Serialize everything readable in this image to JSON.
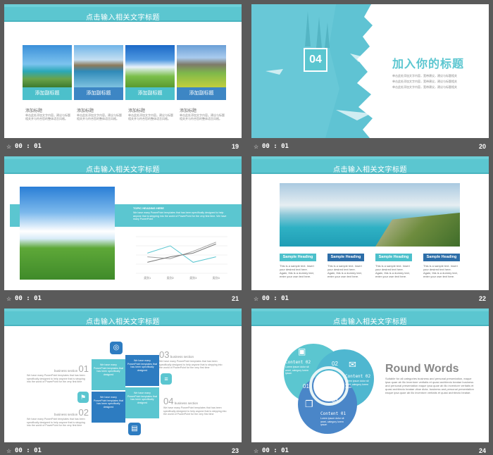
{
  "slides": [
    {
      "id": "s19",
      "number": "19",
      "time": "00 : 01",
      "title": "点击输入相关文字标题",
      "buttons": [
        "添加副标题",
        "添加副标题",
        "添加副标题",
        "添加副标题"
      ],
      "captions": [
        {
          "heading": "添加标题",
          "body": "单击此处添加文字内容。建议与标题相关并与符合您的整体语言风格。"
        },
        {
          "heading": "添加标题",
          "body": "单击此处添加文字内容。建议与标题相关并与符合您的整体语言风格。"
        },
        {
          "heading": "添加标题",
          "body": "单击此处添加文字内容。建议与标题相关并与符合您的整体语言风格。"
        },
        {
          "heading": "添加标题",
          "body": "单击此处添加文字内容。建议与标题相关并与符合您的整体语言风格。"
        }
      ]
    },
    {
      "id": "s20",
      "number": "20",
      "time": "00 : 01",
      "section_number": "04",
      "heading": "加入你的标题",
      "body_lines": [
        "单击此处添加文字内容，宽带建议，建议与标题相关",
        "单击此处添加文字内容，宽带建议，建议与标题相关",
        "单击此处添加文字内容，宽带建议，建议与标题相关"
      ]
    },
    {
      "id": "s21",
      "number": "21",
      "time": "00 : 01",
      "title": "点击输入相关文字标题",
      "text_heading": "TOPIC HEADING HERE",
      "text_body": "We have many PowerPoint templates that has been specifically designed to help anyone that is stepping into the world of PowerPoint for the very first time. We have many PowerPoint",
      "x_labels": [
        "类别1",
        "类别2",
        "类别3",
        "类别4"
      ]
    },
    {
      "id": "s22",
      "number": "22",
      "time": "00 : 01",
      "title": "点击输入相关文字标题",
      "headings": [
        "Sample  Heading",
        "Sample  Heading",
        "Sample  Heading",
        "Sample  Heading"
      ],
      "body": "This is a sample text. Insert your desired text here. Again, this is a dummy text, enter your own text here."
    },
    {
      "id": "s23",
      "number": "23",
      "time": "00 : 01",
      "title": "点击输入相关文字标题",
      "sections": [
        {
          "num": "01",
          "label": "business section",
          "text": "We have many PowerPoint templates that has been specifically designed to help anyone that is stepping into the world of PowerPoint for the very first time"
        },
        {
          "num": "02",
          "label": "business section",
          "text": "We have many PowerPoint templates that has been specifically designed to help anyone that is stepping into the world of PowerPoint for the very first time"
        },
        {
          "num": "03",
          "label": "business section",
          "text": "We have many PowerPoint templates that has been specifically designed to help anyone that is stepping into the world of PowerPoint for the very first time"
        },
        {
          "num": "04",
          "label": "business section",
          "text": "We have many PowerPoint templates that has been specifically designed to help anyone that is stepping into the world of PowerPoint for the very first time"
        }
      ],
      "box_text": "We have many PowerPoint templates that has been specifically designed"
    },
    {
      "id": "s24",
      "number": "24",
      "time": "00 : 01",
      "title": "点击输入相关文字标题",
      "heading": "Round Words",
      "body": "Suitable for all categories business and personal presentation, eaque ipsa quae ab illo inventore veritatis et quasi architecto beatae business and personal presentation eaque ipsa quae ab illo inventore veritatis et quasi architecto beatae vitae dicta. business and personal presentation eaque ipsa quae ab illo inventore veritatis et quasi architecto beatae.",
      "contents": [
        {
          "label": "Content  01",
          "num": "01"
        },
        {
          "label": "Content  02",
          "num": "02"
        },
        {
          "label": "Content  03",
          "num": "03"
        }
      ],
      "content_text": "Lorem ipsum dolor sit amet, category  lorem ipsum"
    }
  ]
}
